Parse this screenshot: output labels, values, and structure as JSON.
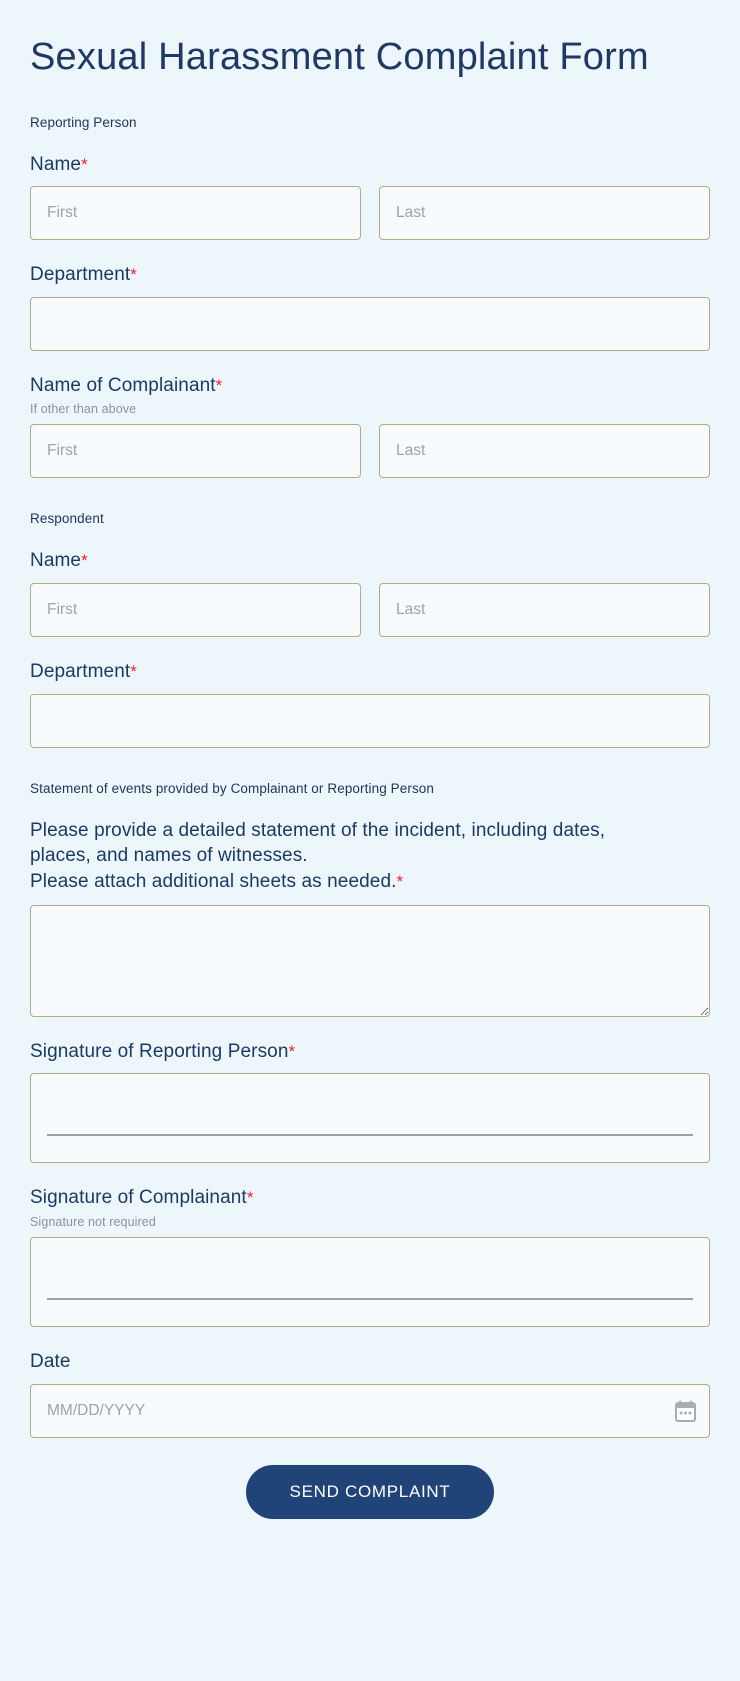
{
  "form": {
    "title": "Sexual Harassment Complaint Form",
    "colors": {
      "page_background": "#edf6fb",
      "title_text": "#203864",
      "label_text": "#1c3a63",
      "required_asterisk": "#f3222f",
      "input_border": "#b3ac84",
      "input_background": "#f8fbfd",
      "placeholder_text": "#9aa3ae",
      "button_background": "#214478",
      "button_text": "#ffffff"
    },
    "sections": {
      "reporting_person": "Reporting Person",
      "respondent": "Respondent",
      "statement": "Statement of events provided by Complainant or Reporting Person"
    },
    "fields": {
      "reporting_name": {
        "label": "Name",
        "required": "*",
        "first_placeholder": "First",
        "last_placeholder": "Last",
        "first_value": "",
        "last_value": ""
      },
      "reporting_department": {
        "label": "Department",
        "required": "*",
        "value": ""
      },
      "complainant_name": {
        "label": "Name of Complainant",
        "required": "*",
        "sub_label": "If other than above",
        "first_placeholder": "First",
        "last_placeholder": "Last",
        "first_value": "",
        "last_value": ""
      },
      "respondent_name": {
        "label": "Name",
        "required": "*",
        "first_placeholder": "First",
        "last_placeholder": "Last",
        "first_value": "",
        "last_value": ""
      },
      "respondent_department": {
        "label": "Department",
        "required": "*",
        "value": ""
      },
      "statement_text": {
        "label_line1": "Please provide a detailed statement of the incident, including dates,",
        "label_line2": "places, and names of witnesses.",
        "label_line3": "Please attach additional sheets as needed.",
        "required": "*",
        "value": ""
      },
      "signature_reporting_person": {
        "label": "Signature of Reporting Person",
        "required": "*"
      },
      "signature_complainant": {
        "label": "Signature of Complainant",
        "required": "*",
        "sub_label": "Signature not required"
      },
      "date": {
        "label": "Date",
        "placeholder": "MM/DD/YYYY",
        "value": "",
        "icon": "calendar-icon"
      }
    },
    "submit_button": "SEND COMPLAINT"
  }
}
